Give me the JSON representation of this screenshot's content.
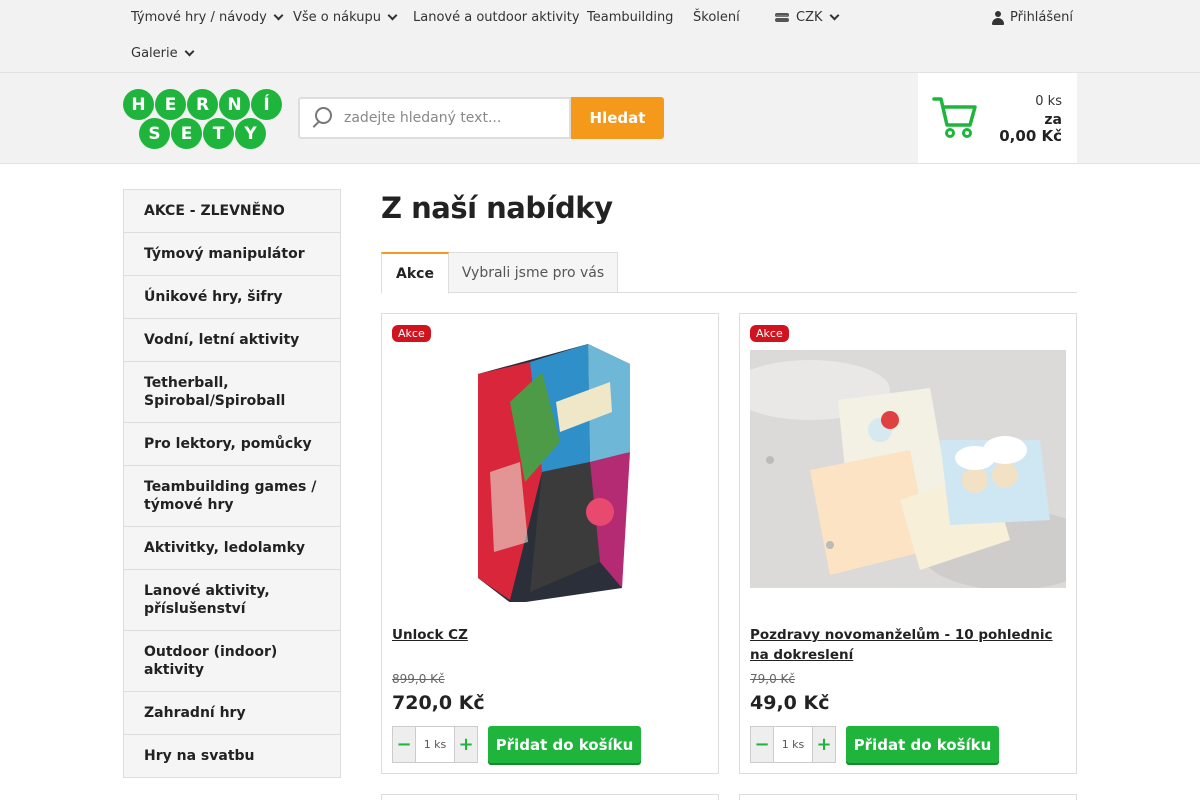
{
  "topnav": {
    "items": [
      {
        "label": "Týmové hry / návody",
        "has_dropdown": true
      },
      {
        "label": "Vše o nákupu",
        "has_dropdown": true
      },
      {
        "label": "Lanové a outdoor aktivity",
        "has_dropdown": false
      },
      {
        "label": "Teambuilding",
        "has_dropdown": false
      },
      {
        "label": "Školení",
        "has_dropdown": false
      },
      {
        "label": "Galerie",
        "has_dropdown": true
      }
    ],
    "currency": "CZK",
    "login_label": "Přihlášení"
  },
  "header": {
    "logo_letters_top": [
      "H",
      "E",
      "R",
      "N",
      "Í"
    ],
    "logo_letters_bottom": [
      "S",
      "E",
      "T",
      "Y"
    ],
    "search_placeholder": "zadejte hledaný text...",
    "search_button": "Hledat",
    "cart": {
      "count": "0 ks",
      "za": "za",
      "total": "0,00 Kč"
    }
  },
  "sidebar": {
    "items": [
      "AKCE - ZLEVNĚNO",
      "Týmový manipulátor",
      "Únikové hry, šifry",
      "Vodní, letní aktivity",
      "Tetherball, Spirobal/Spiroball",
      "Pro lektory, pomůcky",
      "Teambuilding games / týmové hry",
      "Aktivitky, ledolamky",
      "Lanové aktivity, příslušenství",
      "Outdoor (indoor) aktivity",
      "Zahradní hry",
      "Hry na svatbu"
    ]
  },
  "main": {
    "title": "Z naší nabídky",
    "tabs": [
      "Akce",
      "Vybrali jsme pro vás"
    ],
    "products": [
      {
        "badge": "Akce",
        "name": "Unlock CZ",
        "old_price": "899,0 Kč",
        "price": "720,0 Kč",
        "qty": "1 ks",
        "add_label": "Přidat do košíku"
      },
      {
        "badge": "Akce",
        "name": "Pozdravy novomanželům - 10 pohlednic na dokreslení",
        "old_price": "79,0 Kč",
        "price": "49,0 Kč",
        "qty": "1 ks",
        "add_label": "Přidat do košíku"
      }
    ]
  },
  "colors": {
    "brand_green": "#1fb53c",
    "accent_orange": "#f5991b",
    "badge_red": "#d0131f"
  }
}
